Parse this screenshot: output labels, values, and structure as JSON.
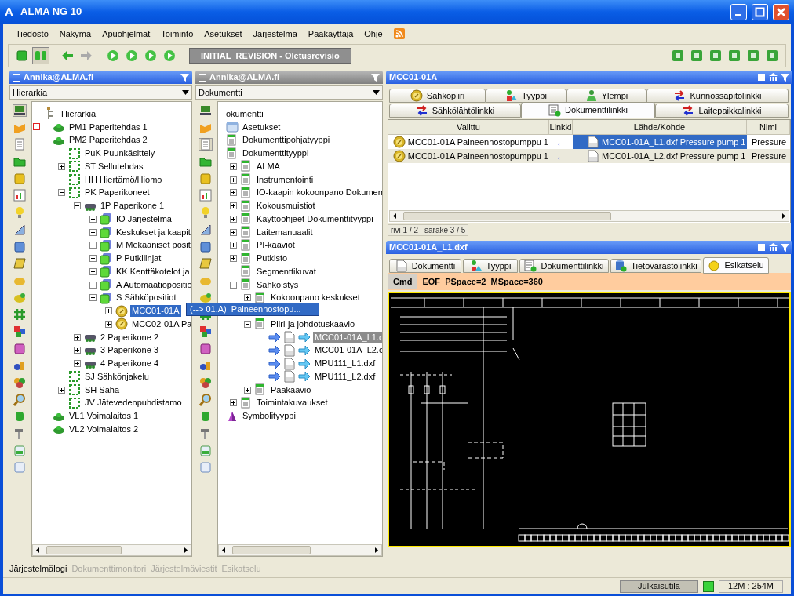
{
  "window": {
    "logo": "A",
    "title": "ALMA NG 10"
  },
  "menu": [
    "Tiedosto",
    "Näkymä",
    "Apuohjelmat",
    "Toiminto",
    "Asetukset",
    "Järjestelmä",
    "Pääkäyttäjä",
    "Ohje"
  ],
  "toolbar": {
    "revision": "INITIAL_REVISION - Oletusrevisio"
  },
  "panels": [
    {
      "header": "Annika@ALMA.fi",
      "active": true,
      "view": "Hierarkia",
      "tree": [
        {
          "label": "Hierarkia",
          "kind": "hierarchy",
          "children": [
            {
              "label": "PM1 Paperitehdas 1",
              "kind": "plant",
              "flagged": true
            },
            {
              "label": "PM2 Paperitehdas 2",
              "kind": "plant",
              "flagged": false,
              "children": [
                {
                  "label": "PuK Puunkäsittely",
                  "kind": "area"
                },
                {
                  "label": "ST Sellutehdas",
                  "kind": "area",
                  "expanded": false
                },
                {
                  "label": "HH Hiertämö/Hiomo",
                  "kind": "area"
                },
                {
                  "label": "PK Paperikoneet",
                  "kind": "area",
                  "expanded": true,
                  "children": [
                    {
                      "label": "1P Paperikone 1",
                      "kind": "machine",
                      "expanded": true,
                      "children": [
                        {
                          "label": "IO Järjestelmä",
                          "kind": "group",
                          "expanded": false
                        },
                        {
                          "label": "Keskukset ja kaapit",
                          "kind": "group",
                          "expanded": false
                        },
                        {
                          "label": "M Mekaaniset positi",
                          "kind": "group",
                          "expanded": false
                        },
                        {
                          "label": "P Putkilinjat",
                          "kind": "group",
                          "expanded": false
                        },
                        {
                          "label": "KK Kenttäkotelot ja",
                          "kind": "group",
                          "expanded": false
                        },
                        {
                          "label": "A Automaatiopositio",
                          "kind": "group",
                          "expanded": false
                        },
                        {
                          "label": "S Sähköpositiot",
                          "kind": "group",
                          "expanded": true,
                          "children": [
                            {
                              "label": "MCC01-01A",
                              "kind": "circuit",
                              "expanded": false,
                              "selected": true
                            },
                            {
                              "label": "MCC02-01A Pa",
                              "kind": "circuit",
                              "expanded": false,
                              "selected": false
                            }
                          ]
                        }
                      ]
                    },
                    {
                      "label": "2 Paperikone 2",
                      "kind": "machine",
                      "expanded": false
                    },
                    {
                      "label": "3 Paperikone 3",
                      "kind": "machine",
                      "expanded": false
                    },
                    {
                      "label": "4 Paperikone 4",
                      "kind": "machine",
                      "expanded": false
                    }
                  ]
                },
                {
                  "label": "SJ Sähkönjakelu",
                  "kind": "area"
                },
                {
                  "label": "SH Saha",
                  "kind": "area",
                  "expanded": false
                },
                {
                  "label": "JV Jätevedenpuhdistamo",
                  "kind": "area"
                }
              ]
            },
            {
              "label": "VL1 Voimalaitos 1",
              "kind": "plant",
              "flagged": false
            },
            {
              "label": "VL2 Voimalaitos 2",
              "kind": "plant",
              "flagged": false
            }
          ]
        }
      ]
    },
    {
      "header": "Annika@ALMA.fi",
      "active": false,
      "view": "Dokumentti",
      "tree": [
        {
          "label": "okumentti",
          "children": [
            {
              "label": "Asetukset",
              "kind": "settings"
            },
            {
              "label": "Dokumenttipohjatyyppi",
              "kind": "doc"
            },
            {
              "label": "Dokumenttityyppi",
              "kind": "doc",
              "children": [
                {
                  "label": "ALMA",
                  "kind": "doc",
                  "expanded": false
                },
                {
                  "label": "Instrumentointi",
                  "kind": "doc",
                  "expanded": false
                },
                {
                  "label": "IO-kaapin kokoonpano Dokumen",
                  "kind": "doc",
                  "expanded": false
                },
                {
                  "label": "Kokousmuistiot",
                  "kind": "doc",
                  "expanded": false
                },
                {
                  "label": "Käyttöohjeet Dokumenttityyppi",
                  "kind": "doc",
                  "expanded": false
                },
                {
                  "label": "Laitemanuaalit",
                  "kind": "doc",
                  "expanded": false
                },
                {
                  "label": "PI-kaaviot",
                  "kind": "doc",
                  "expanded": false
                },
                {
                  "label": "Putkisto",
                  "kind": "doc",
                  "expanded": false
                },
                {
                  "label": "Segmenttikuvat",
                  "kind": "doc"
                },
                {
                  "label": "Sähköistys",
                  "kind": "doc",
                  "expanded": true,
                  "children": [
                    {
                      "label": "Kokoonpano keskukset",
                      "kind": "doc",
                      "expanded": false
                    },
                    {
                      "kind": "covered"
                    },
                    {
                      "label": "Piiri-ja johdotuskaavio",
                      "kind": "doc",
                      "expanded": true,
                      "children": [
                        {
                          "label": "MCC01-01A_L1.c",
                          "kind": "dxf",
                          "selected": true
                        },
                        {
                          "label": "MCC01-01A_L2.c",
                          "kind": "dxf",
                          "selected": false
                        },
                        {
                          "label": "MPU111_L1.dxf",
                          "kind": "dxf",
                          "selected": false
                        },
                        {
                          "label": "MPU111_L2.dxf",
                          "kind": "dxf",
                          "selected": false
                        }
                      ]
                    },
                    {
                      "label": "Pääkaavio",
                      "kind": "doc",
                      "expanded": false
                    }
                  ]
                },
                {
                  "label": "Toimintakuvaukset",
                  "kind": "doc",
                  "expanded": false
                }
              ]
            },
            {
              "label": "Symbolityyppi",
              "kind": "symbol"
            }
          ]
        }
      ]
    }
  ],
  "tooltip": "(--> 01.A)  Paineennostopu...",
  "detail": {
    "title": "MCC01-01A",
    "tab_rows": [
      [
        {
          "label": "Sähköpiiri",
          "kind": "circuit",
          "selected": false
        },
        {
          "label": "Tyyppi",
          "kind": "type",
          "selected": false
        },
        {
          "label": "Ylempi",
          "kind": "parent",
          "selected": false
        },
        {
          "label": "Kunnossapitolinkki",
          "kind": "link",
          "selected": false
        }
      ],
      [
        {
          "label": "Sähkölähtölinkki",
          "kind": "link",
          "selected": false
        },
        {
          "label": "Dokumenttilinkki",
          "kind": "doc-link",
          "selected": true
        },
        {
          "label": "Laitepaikkalinkki",
          "kind": "link",
          "selected": false
        }
      ]
    ],
    "table": {
      "columns": [
        "Valittu",
        "Linkki",
        "Lähde/Kohde",
        "Nimi"
      ],
      "rows": [
        {
          "selected": true,
          "cells": [
            "MCC01-01A Paineennostopumppu 1",
            "←",
            "MCC01-01A_L1.dxf Pressure pump 1",
            "Pressure"
          ]
        },
        {
          "selected": false,
          "cells": [
            "MCC01-01A Paineennostopumppu 1",
            "←",
            "MCC01-01A_L2.dxf Pressure pump 1",
            "Pressure"
          ]
        }
      ]
    },
    "position": [
      "rivi 1 / 2",
      "sarake 3 / 5"
    ]
  },
  "preview": {
    "title": "MCC01-01A_L1.dxf",
    "tabs": [
      {
        "label": "Dokumentti",
        "kind": "dxf",
        "selected": false
      },
      {
        "label": "Tyyppi",
        "kind": "type",
        "selected": false
      },
      {
        "label": "Dokumenttilinkki",
        "kind": "doc-link",
        "selected": false
      },
      {
        "label": "Tietovarastolinkki",
        "kind": "db-link",
        "selected": false
      },
      {
        "label": "Esikatselu",
        "kind": "preview",
        "selected": true
      }
    ],
    "command": {
      "button": "Cmd",
      "output": "EOF  PSpace=2  MSpace=360"
    }
  },
  "bottom_tabs": [
    {
      "label": "Järjestelmälogi",
      "selected": true
    },
    {
      "label": "Dokumenttimonitori",
      "selected": false
    },
    {
      "label": "Järjestelmäviestit",
      "selected": false
    },
    {
      "label": "Esikatselu",
      "selected": false
    }
  ],
  "status_bar": {
    "mode": "Julkaisutila",
    "memory": "12M : 254M"
  }
}
